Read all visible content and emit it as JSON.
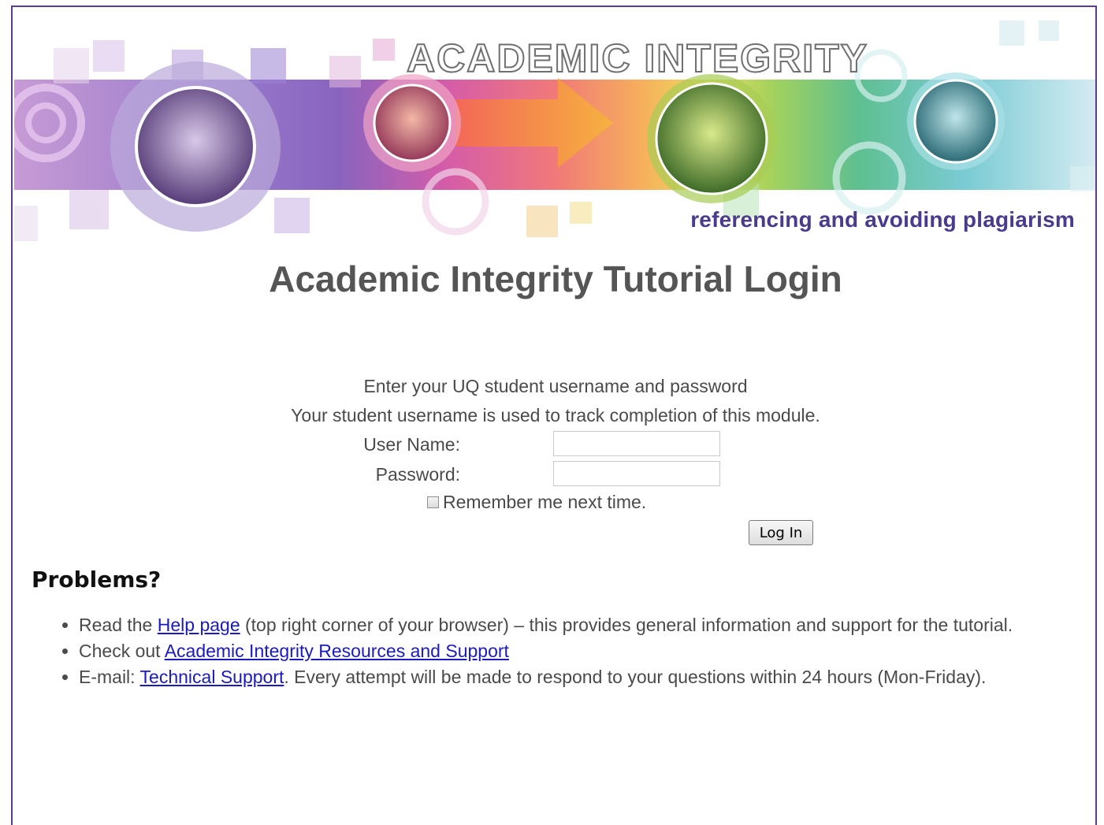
{
  "banner": {
    "heading": "ACADEMIC INTEGRITY",
    "tagline": "referencing and avoiding plagiarism"
  },
  "page_title": "Academic Integrity Tutorial Login",
  "login": {
    "instruction_1": "Enter your UQ student username and password",
    "instruction_2": "Your student username is used to track completion of this module.",
    "username_label": "User Name:",
    "username_value": "",
    "password_label": "Password:",
    "password_value": "",
    "remember_label": "Remember me next time.",
    "remember_checked": false,
    "submit_label": "Log In"
  },
  "problems": {
    "heading": "Problems?",
    "items": [
      {
        "prefix": "Read the ",
        "link": "Help page",
        "suffix": " (top right corner of your browser) – this provides general information and support for the tutorial."
      },
      {
        "prefix": "Check out ",
        "link": "Academic Integrity Resources and Support",
        "suffix": ""
      },
      {
        "prefix": "E-mail: ",
        "link": "Technical Support",
        "suffix": ". Every attempt will be made to respond to your questions within 24 hours (Mon-Friday)."
      }
    ]
  },
  "colors": {
    "frame_border": "#5b3d8f",
    "tagline": "#4b3b8c",
    "link": "#1b1bbd",
    "title": "#555555"
  }
}
